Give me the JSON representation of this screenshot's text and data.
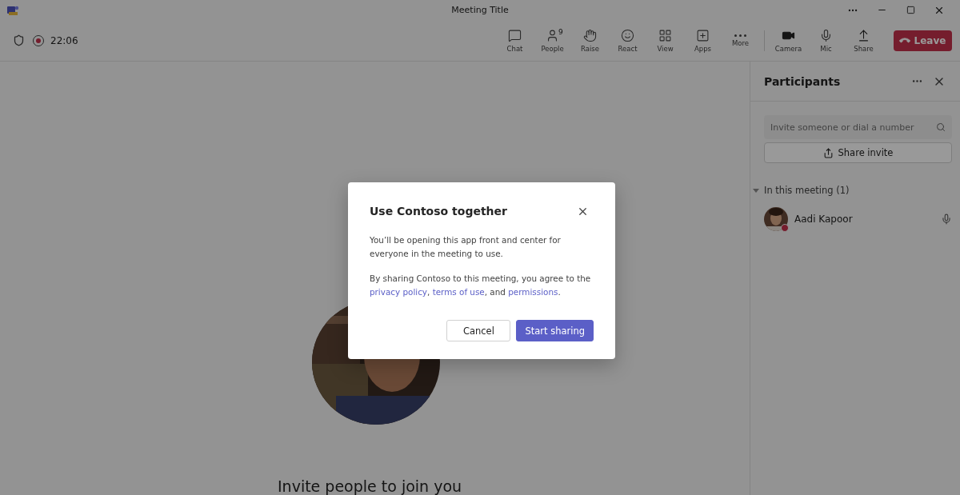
{
  "window": {
    "title": "Meeting Title"
  },
  "meeting": {
    "timer": "22:06",
    "recording": true
  },
  "toolbar": [
    {
      "kind": "chat",
      "label": "Chat"
    },
    {
      "kind": "people",
      "label": "People",
      "badge": "9"
    },
    {
      "kind": "raise",
      "label": "Raise"
    },
    {
      "kind": "react",
      "label": "React"
    },
    {
      "kind": "view",
      "label": "View"
    },
    {
      "kind": "apps",
      "label": "Apps"
    },
    {
      "kind": "more",
      "label": "More"
    },
    {
      "kind": "camera",
      "label": "Camera"
    },
    {
      "kind": "mic",
      "label": "Mic"
    },
    {
      "kind": "share",
      "label": "Share"
    }
  ],
  "leave_button": "Leave",
  "stage": {
    "message": "Invite people to join you"
  },
  "participants_panel": {
    "title": "Participants",
    "search": {
      "placeholder": "Invite someone or dial a number"
    },
    "share_invite": "Share invite",
    "section": {
      "label": "In this meeting (1)",
      "expanded": true
    },
    "people": [
      {
        "name": "Aadi Kapoor"
      }
    ]
  },
  "dialog": {
    "title": "Use Contoso together",
    "description": "You’ll be opening this app front and center for everyone in the meeting to use.",
    "consent": [
      {
        "kind": "text",
        "text": "By sharing Contoso to this meeting,  you agree to the "
      },
      {
        "kind": "link",
        "text": "privacy policy"
      },
      {
        "kind": "text",
        "text": ", "
      },
      {
        "kind": "link",
        "text": "terms of use"
      },
      {
        "kind": "text",
        "text": ", and "
      },
      {
        "kind": "link",
        "text": "permissions"
      },
      {
        "kind": "text",
        "text": "."
      }
    ],
    "buttons": [
      {
        "label": "Cancel",
        "primary": false
      },
      {
        "label": "Start sharing",
        "primary": true
      }
    ]
  }
}
